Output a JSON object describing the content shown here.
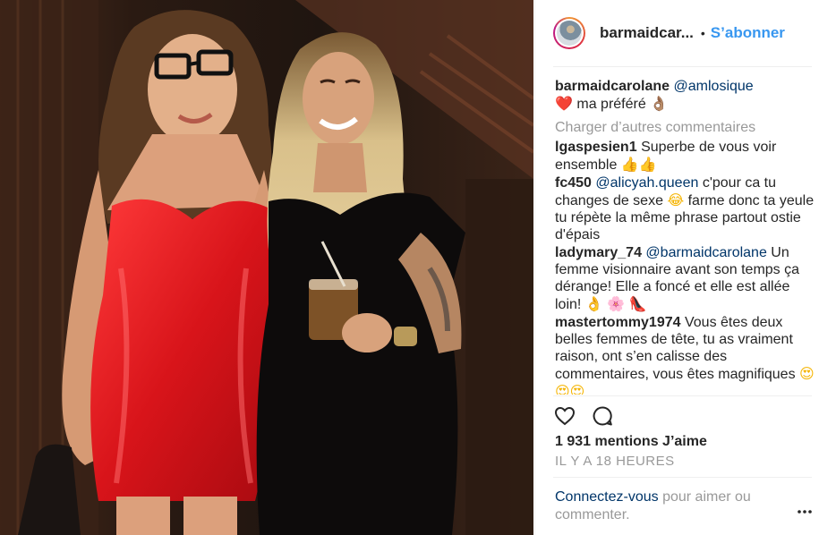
{
  "header": {
    "username": "barmaidcar...",
    "separator": "•",
    "follow_label": "S’abonner"
  },
  "caption": {
    "user": "barmaidcarolane",
    "mention": "@amlosique",
    "heart": "❤️",
    "text": "ma préféré",
    "emoji": "👌🏽"
  },
  "load_more": "Charger d’autres commentaires",
  "comments": [
    {
      "user": "lgaspesien1",
      "text": "Superbe de vous voir ensemble",
      "emoji": "👍👍"
    },
    {
      "user": "fc450",
      "mention": "@alicyah.queen",
      "text1": "c'pour ca tu changes de sexe",
      "emoji": "😂",
      "text2": "farme donc ta yeule tu répète la même phrase partout ostie d'épais"
    },
    {
      "user": "ladymary_74",
      "mention": "@barmaidcarolane",
      "text": "Un femme visionnaire avant son temps ça dérange! Elle a foncé et elle est allée loin!",
      "emoji1": "👌",
      "emoji2": "🌸",
      "emoji3": "👠"
    },
    {
      "user": "mastertommy1974",
      "text": "Vous êtes deux belles femmes de tête, tu as vraiment raison, ont s’en calisse des commentaires, vous êtes magnifiques",
      "emoji": "😍😍😍"
    }
  ],
  "actions": {
    "like_icon": "heart-outline-icon",
    "comment_icon": "comment-bubble-icon"
  },
  "likes": "1 931 mentions J’aime",
  "timestamp": "IL Y A 18 HEURES",
  "footer": {
    "login": "Connectez-vous",
    "rest": "pour aimer ou commenter."
  },
  "more_icon": "more-dots-icon"
}
